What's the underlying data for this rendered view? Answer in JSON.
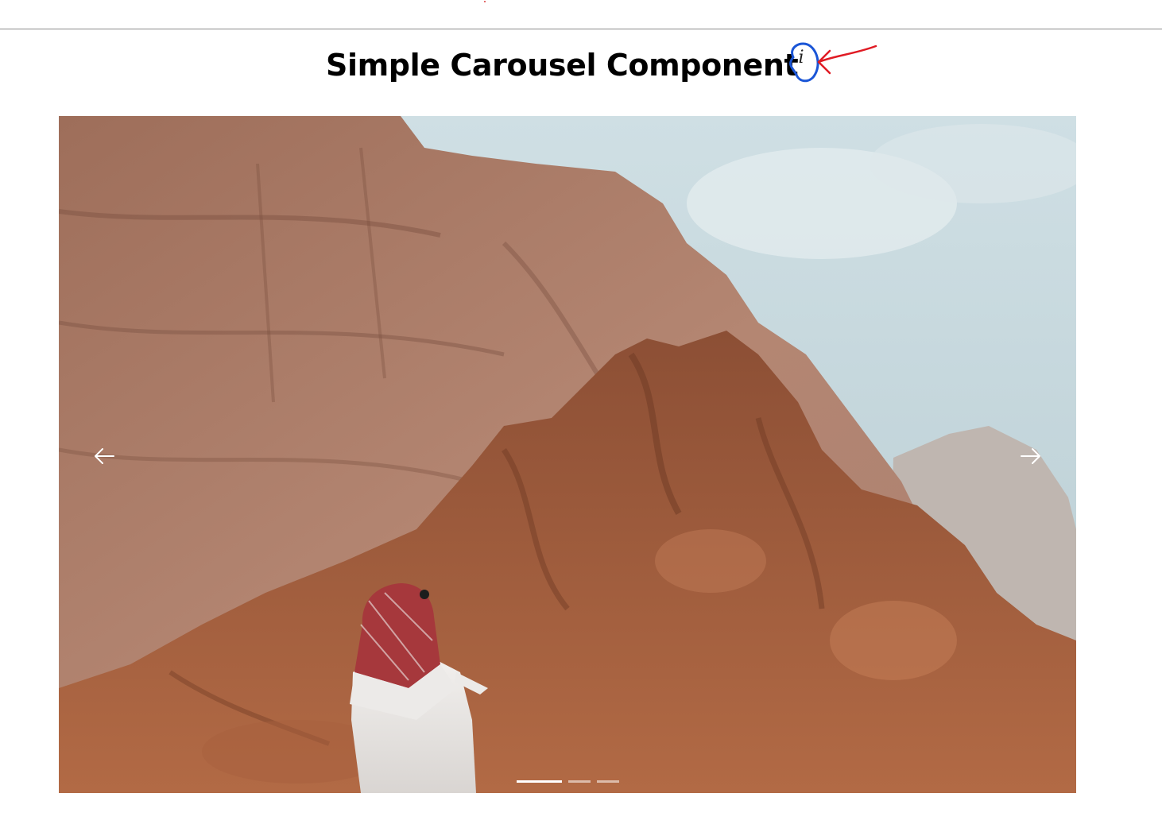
{
  "page": {
    "title": "Simple Carousel Component"
  },
  "info": {
    "icon": "info-icon",
    "glyph": "i",
    "annotation_colors": {
      "circle": "#1a55d6",
      "arrow": "#e01b24"
    }
  },
  "carousel": {
    "slide_count": 3,
    "active_index": 0,
    "prev_icon": "arrow-left-icon",
    "next_icon": "arrow-right-icon",
    "slides": [
      {
        "label": "desert-rock-canyon-photo"
      },
      {
        "label": "slide-2"
      },
      {
        "label": "slide-3"
      }
    ]
  },
  "colors": {
    "page_bg": "#ffffff",
    "title": "#000000",
    "rule": "#8a8a8a",
    "indicator_active": "#ffffff",
    "indicator_inactive": "rgba(255,255,255,0.55)"
  }
}
